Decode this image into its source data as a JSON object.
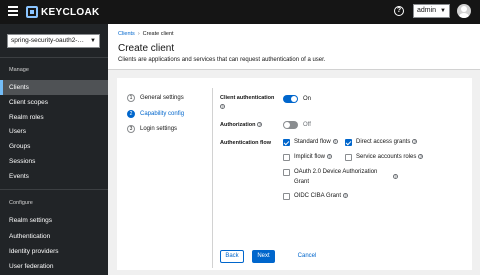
{
  "header": {
    "logo_text": "KEYCLOAK",
    "user": "admin",
    "icons": [
      "hamburger-icon",
      "help-icon",
      "avatar"
    ]
  },
  "sidebar": {
    "realm": "spring-security-oauth2-…",
    "manage_title": "Manage",
    "manage_items": [
      "Clients",
      "Client scopes",
      "Realm roles",
      "Users",
      "Groups",
      "Sessions",
      "Events"
    ],
    "active_item": "Clients",
    "configure_title": "Configure",
    "configure_items": [
      "Realm settings",
      "Authentication",
      "Identity providers",
      "User federation"
    ]
  },
  "page": {
    "breadcrumb": [
      "Clients",
      "Create client"
    ],
    "title": "Create client",
    "description": "Clients are applications and services that can request authentication of a user."
  },
  "wizard": {
    "steps": [
      {
        "num": "1",
        "label": "General settings"
      },
      {
        "num": "2",
        "label": "Capability config"
      },
      {
        "num": "3",
        "label": "Login settings"
      }
    ],
    "current_step": 2
  },
  "form": {
    "client_auth_label": "Client authentication",
    "client_auth_state": "On",
    "client_auth_on": true,
    "authorization_label": "Authorization",
    "authorization_state": "Off",
    "authorization_on": false,
    "auth_flow_label": "Authentication flow",
    "flows": {
      "standard": {
        "label": "Standard flow",
        "checked": true
      },
      "direct": {
        "label": "Direct access grants",
        "checked": true
      },
      "implicit": {
        "label": "Implicit flow",
        "checked": false
      },
      "service": {
        "label": "Service accounts roles",
        "checked": false
      },
      "device_line1": "OAuth 2.0 Device Authorization",
      "device_line2": "Grant",
      "device_checked": false,
      "ciba": {
        "label": "OIDC CIBA Grant",
        "checked": false
      }
    }
  },
  "buttons": {
    "back": "Back",
    "next": "Next",
    "cancel": "Cancel"
  },
  "colors": {
    "accent": "#0066cc",
    "masthead": "#151515",
    "sidebar": "#212427"
  }
}
